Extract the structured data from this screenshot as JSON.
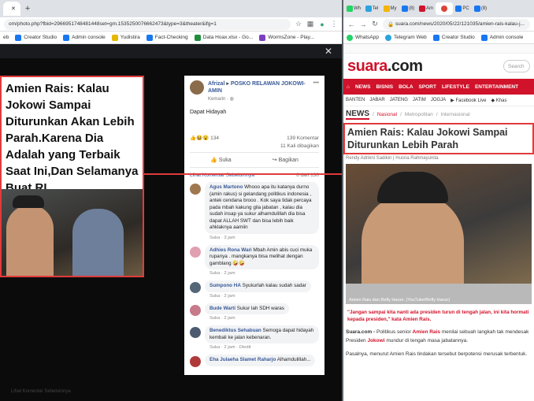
{
  "left_browser": {
    "tab_title": "",
    "url": "om/photo.php?fbid=2966951748481448set=gm.1535250076662473&type=3&theater&ifg=1",
    "bookmarks": [
      "eb",
      "Creator Studio",
      "Admin console",
      "Yudistira",
      "Fact-Checking",
      "Data Hoax.xlsx - Go...",
      "WormsZone - Play..."
    ]
  },
  "photo": {
    "headline": "Amien Rais: Kalau Jokowi Sampai Diturunkan Akan Lebih Parah.Karena Dia Adalah yang Terbaik Saat Ini,Dan Selamanya Buat RI"
  },
  "post": {
    "poster": "Afrizal",
    "group": "POSKO RELAWAN JOKOWI-AMIN",
    "time": "Kemarin",
    "text": "Dapat Hidayah",
    "reaction_count": "134",
    "comments_count": "139 Komentar",
    "shares_count": "11 Kali dibagikan",
    "like_label": "Suka",
    "share_label": "Bagikan",
    "prev_comments": "Lihat Komentar Sebelumnya",
    "page_counter": "6 dari 130"
  },
  "comments": [
    {
      "name": "Agus Martono",
      "text": "Whooo apa itu katanya durno (amin rakus) si gelandang politikus indonesia , antek cendana brooo . Kok saya tidak percaya pada mbah kakung gila jabatan , kalau dia sudah insap ya sukur alhamdulillah dia bisa dapat ALLAH SWT dan bisa lebih baik ahklaknya aamiin",
      "meta": "Suka · 3 jam",
      "color": "#a07850"
    },
    {
      "name": "Adhies Rona Wari",
      "text": "Mbah Amin abis cuci muka rupanya . mangkanya bisa melihat dengan gamblang 🤪🤪",
      "meta": "Suka · 2 jam",
      "color": "#e0a0b0"
    },
    {
      "name": "Sumpono HA",
      "text": "Syukurlah kalau sudah sadar",
      "meta": "Suka · 2 jam",
      "color": "#556677"
    },
    {
      "name": "Bude Warti",
      "text": "Sukur lah SDH waras",
      "meta": "Suka · 2 jam",
      "color": "#c77a8a"
    },
    {
      "name": "Benediktus Sehabuan",
      "text": "Semoga dapat hidayah kembali ke jalan kebenaran.",
      "meta": "Suka · 2 jam · Diedit",
      "color": "#4d5b70"
    },
    {
      "name": "Eha Julaeha Slamet Raharjo",
      "text": "Alhamdulillah...",
      "meta": "",
      "color": "#b03a3a"
    }
  ],
  "dark_footer": "Lihat Komentar Sebelumnya",
  "right_browser": {
    "tabs": [
      "Wh",
      "Tel",
      "My",
      "(8)",
      "Am",
      "",
      "PC",
      "(8)"
    ],
    "url": "suara.com/news/2020/05/22/121035/amien-rais-kalau-j...",
    "bookmarks": [
      "WhatsApp",
      "Telegram Web",
      "Creator Studio",
      "Admin console"
    ]
  },
  "suara": {
    "logo_main": "suara",
    "logo_tld": ".com",
    "search_placeholder": "Search",
    "nav": [
      "NEWS",
      "BISNIS",
      "BOLA",
      "SPORT",
      "LIFESTYLE",
      "ENTERTAINMENT"
    ],
    "subnav": [
      "BANTEN",
      "JABAR",
      "JATENG",
      "JATIM",
      "JOGJA",
      "Facebook Live",
      "Khas"
    ],
    "crumb": [
      "NEWS",
      "Nasional",
      "Metropolitan",
      "Internasional"
    ],
    "title": "Amien Rais: Kalau Jokowi Sampai Diturunkan Lebih Parah",
    "byline": "Rendy Adrikni Sadikin | Husna Rahmayunita",
    "img_caption": "Amien Rais dan Refly Harun. (YouTube/Refly Harun)",
    "quote": "\"Jangan sampai kita nanti ada presiden turun di tengah jalan, ini kita hormati kepada presiden,\" kata Amien Rais.",
    "para1_a": "Suara.com -",
    "para1_b": " Politikus senior ",
    "para1_name": "Amien Rais",
    "para1_c": " menilai sebuah langkah tak mendesak Presiden ",
    "para1_jokowi": "Jokowi",
    "para1_d": " mundur di tengah masa jabatannya.",
    "para2": "Pasalnya, menurut Amien Rais tindakan tersebut berpotensi merusak terbentuk."
  }
}
